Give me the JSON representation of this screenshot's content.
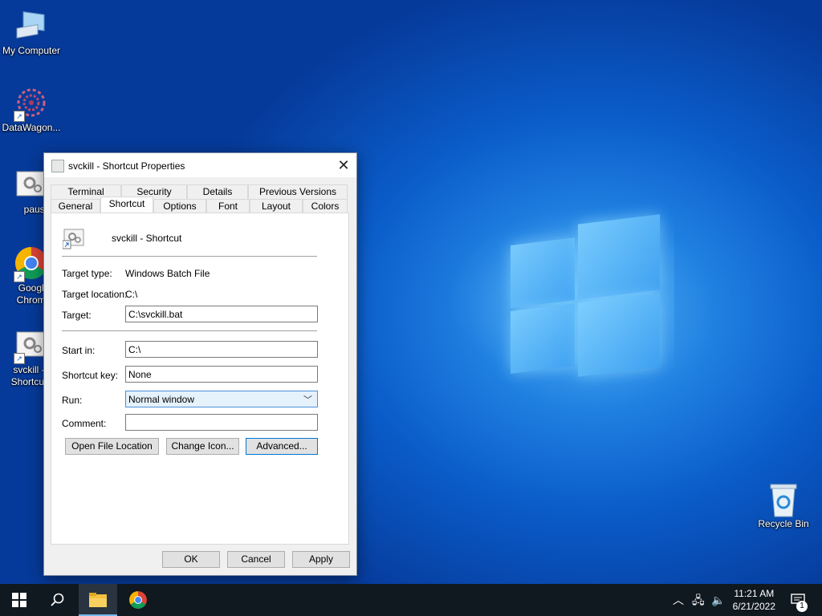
{
  "desktop": {
    "icons": [
      {
        "label": "My Computer",
        "icon": "computer-icon"
      },
      {
        "label": "DataWagon...",
        "icon": "datawagon-icon"
      },
      {
        "label": "pause",
        "icon": "batch-file-icon"
      },
      {
        "label": "Google Chrome",
        "icon": "chrome-icon"
      },
      {
        "label": "svckill - Shortcut",
        "icon": "batch-file-icon"
      },
      {
        "label": "Recycle Bin",
        "icon": "recycle-bin-icon"
      }
    ]
  },
  "dialog": {
    "title": "svckill - Shortcut Properties",
    "close_glyph": "✕",
    "tabs_row1": [
      "Terminal",
      "Security",
      "Details",
      "Previous Versions"
    ],
    "tabs_row2": [
      "General",
      "Shortcut",
      "Options",
      "Font",
      "Layout",
      "Colors"
    ],
    "active_tab": "Shortcut",
    "shortcut_name": "svckill - Shortcut",
    "target_type_label": "Target type:",
    "target_type_value": "Windows Batch File",
    "target_location_label": "Target location:",
    "target_location_value": "C:\\",
    "target_label": "Target:",
    "target_value": "C:\\svckill.bat",
    "start_in_label": "Start in:",
    "start_in_value": "C:\\",
    "shortcut_key_label": "Shortcut key:",
    "shortcut_key_value": "None",
    "run_label": "Run:",
    "run_value": "Normal window",
    "comment_label": "Comment:",
    "comment_value": "",
    "open_file_location": "Open File Location",
    "change_icon": "Change Icon...",
    "advanced": "Advanced...",
    "ok": "OK",
    "cancel": "Cancel",
    "apply": "Apply"
  },
  "taskbar": {
    "time": "11:21 AM",
    "date": "6/21/2022",
    "notification_count": "1",
    "accent": "#76b9ed"
  }
}
